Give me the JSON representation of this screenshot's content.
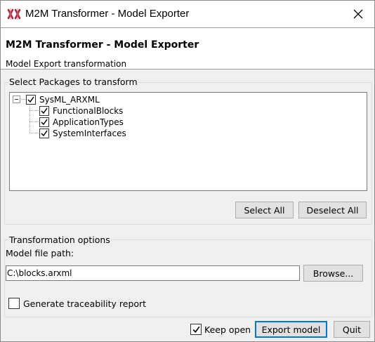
{
  "window": {
    "title": "M2M Transformer - Model Exporter"
  },
  "header": {
    "title": "M2M Transformer - Model Exporter",
    "subtitle": "Model Export transformation"
  },
  "packages": {
    "group_label": "Select Packages to transform",
    "tree": {
      "root": {
        "label": "SysML_ARXML",
        "checked": true,
        "expanded": true
      },
      "children": [
        {
          "label": "FunctionalBlocks",
          "checked": true
        },
        {
          "label": "ApplicationTypes",
          "checked": true
        },
        {
          "label": "SystemInterfaces",
          "checked": true
        }
      ]
    },
    "select_all_label": "Select All",
    "deselect_all_label": "Deselect All"
  },
  "options": {
    "group_label": "Transformation options",
    "path_label": "Model file path:",
    "path_value": "C:\\blocks.arxml",
    "browse_label": "Browse...",
    "traceability_label": "Generate traceability report",
    "traceability_checked": false
  },
  "footer": {
    "keep_open_label": "Keep open",
    "keep_open_checked": true,
    "export_label": "Export model",
    "quit_label": "Quit"
  },
  "icons": {
    "app": "app-logo-icon",
    "close": "close-icon",
    "check": "checkmark-icon",
    "collapse": "minus-expander-icon"
  },
  "colors": {
    "window_bg": "#f0f0f0",
    "accent": "#0078d7",
    "app_icon": "#b0263a"
  }
}
